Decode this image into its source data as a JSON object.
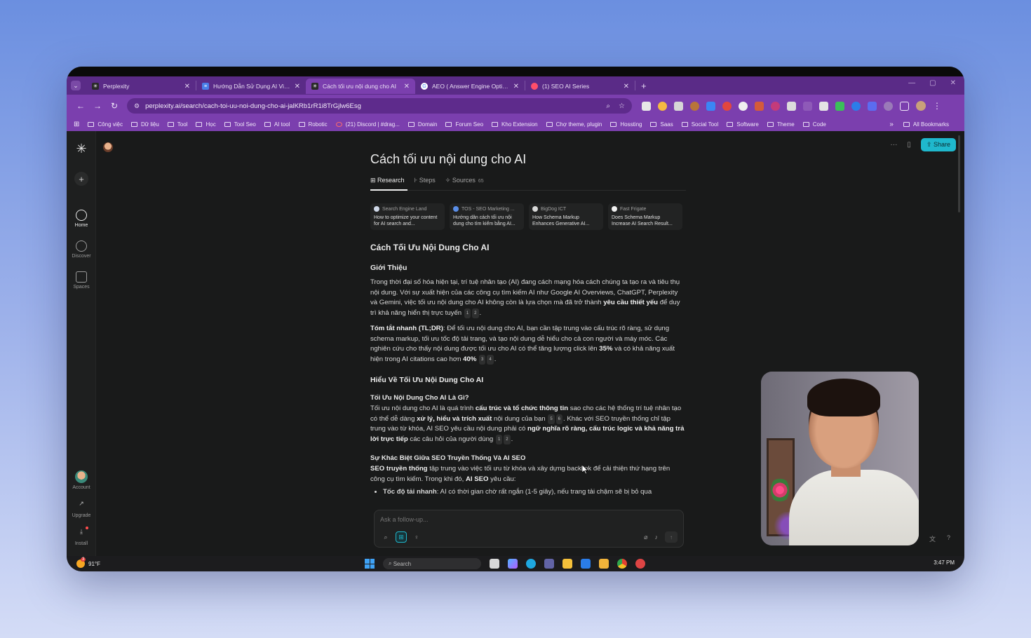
{
  "browser": {
    "tabs": [
      {
        "title": "Perplexity",
        "active": false
      },
      {
        "title": "Hướng Dẫn Sử Dụng AI Viết Bài",
        "active": false
      },
      {
        "title": "Cách tối ưu nội dung cho AI",
        "active": true
      },
      {
        "title": "AEO ( Answer Engine Optimization )",
        "active": false
      },
      {
        "title": "(1) SEO AI Series",
        "active": false
      }
    ],
    "new_tab": "+",
    "url": "perplexity.ai/search/cach-toi-uu-noi-dung-cho-ai-jalKRb1rR1i8TrGjlw6Esg",
    "bookmarks": [
      "Công việc",
      "Dữ liệu",
      "Tool",
      "Học",
      "Tool Seo",
      "AI tool",
      "Robotic",
      "(21) Discord | #drag...",
      "Domain",
      "Forum Seo",
      "Kho Extension",
      "Chợ theme, plugin",
      "Hossting",
      "Saas",
      "Social Tool",
      "Software",
      "Theme",
      "Code"
    ],
    "all_bookmarks": "All Bookmarks"
  },
  "sidebar": {
    "home": "Home",
    "discover": "Discover",
    "spaces": "Spaces",
    "account": "Account",
    "upgrade": "Upgrade",
    "install": "Install"
  },
  "header": {
    "share": "Share",
    "more": "···"
  },
  "thread": {
    "title": "Cách tối ưu nội dung cho AI",
    "tabs": {
      "research": "Research",
      "steps": "Steps",
      "sources": "Sources",
      "sources_count": "65"
    },
    "sources": [
      {
        "site": "Search Engine Land",
        "title": "How to optimize your content for AI search and..."
      },
      {
        "site": "TOS - SEO Marketing ...",
        "title": "Hướng dẫn cách tối ưu nội dung cho tìm kiếm bằng AI..."
      },
      {
        "site": "BigDog ICT",
        "title": "How Schema Markup Enhances Generative AI..."
      },
      {
        "site": "Fast Frigate",
        "title": "Does Schema Markup Increase AI Search Result..."
      }
    ],
    "h_main": "Cách Tối Ưu Nội Dung Cho AI",
    "h_intro": "Giới Thiệu",
    "intro_1": "Trong thời đại số hóa hiện tại, trí tuệ nhân tạo (AI) đang cách mạng hóa cách chúng ta tạo ra và tiêu thụ nội dung. Với sự xuất hiện của các công cụ tìm kiếm AI như Google AI Overviews, ChatGPT, Perplexity và Gemini, việc tối ưu nội dung cho AI không còn là lựa chọn mà đã trở thành ",
    "intro_bold": "yêu cầu thiết yếu",
    "intro_2": " để duy trì khả năng hiển thị trực tuyến",
    "tldr_label": "Tóm tắt nhanh (TL;DR)",
    "tldr_1": ": Để tối ưu nội dung cho AI, bạn cần tập trung vào cấu trúc rõ ràng, sử dụng schema markup, tối ưu tốc độ tải trang, và tạo nội dung dễ hiểu cho cả con người và máy móc. Các nghiên cứu cho thấy nội dung được tối ưu cho AI có thể tăng lượng click lên ",
    "tldr_35": "35%",
    "tldr_2": " và có khả năng xuất hiện trong AI citations cao hơn ",
    "tldr_40": "40%",
    "h_understand": "Hiểu Về Tối Ưu Nội Dung Cho AI",
    "h_what": "Tối Ưu Nội Dung Cho AI Là Gì?",
    "what_1": "Tối ưu nội dung cho AI là quá trình ",
    "what_b1": "cấu trúc và tổ chức thông tin",
    "what_2": " sao cho các hệ thống trí tuệ nhân tạo có thể dễ dàng ",
    "what_b2": "xử lý, hiểu và trích xuất",
    "what_3": " nội dung của bạn",
    "what_4": ". Khác với SEO truyền thống chỉ tập trung vào từ khóa, AI SEO yêu cầu nội dung phải có ",
    "what_b3": "ngữ nghĩa rõ ràng, cấu trúc logic và khả năng trả lời trực tiếp",
    "what_5": " các câu hỏi của người dùng",
    "h_diff": "Sự Khác Biệt Giữa SEO Truyền Thống Và AI SEO",
    "diff_b1": "SEO truyền thống",
    "diff_1": " tập trung vào việc tối ưu từ khóa và xây dựng backlink để cải thiện thứ hạng trên công cụ tìm kiếm. Trong khi đó, ",
    "diff_b2": "AI SEO",
    "diff_2": " yêu cầu:",
    "bullet_b": "Tốc độ tải nhanh",
    "bullet": ": AI có thời gian chờ rất ngắn (1-5 giây), nếu trang tải chậm sẽ bị bỏ qua",
    "cites": {
      "c1": "1",
      "c2": "2",
      "c3": "3",
      "c4": "4",
      "c5": "5",
      "c6": "6"
    }
  },
  "followup": {
    "placeholder": "Ask a follow-up..."
  },
  "taskbar": {
    "temp": "91°F",
    "notif": "3",
    "search": "Search",
    "time": "3:47 PM"
  },
  "colors": {
    "accent": "#1fb8cd",
    "browser_chrome": "#7b3fae",
    "background": "#191a1a"
  }
}
